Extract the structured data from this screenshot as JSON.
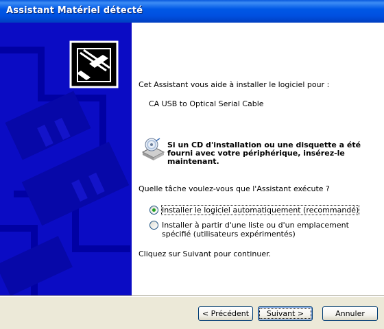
{
  "window": {
    "title": "Assistant Matériel détecté"
  },
  "content": {
    "intro": "Cet Assistant vous aide à installer le logiciel pour :",
    "device_name": "CA USB to Optical Serial Cable",
    "cd_notice": "Si un CD d'installation ou une disquette a été fourni avec votre périphérique, insérez-le maintenant.",
    "question": "Quelle tâche voulez-vous que l'Assistant exécute ?",
    "options": [
      {
        "label": "Installer le logiciel automatiquement (recommandé)",
        "selected": true
      },
      {
        "label": "Installer à partir d'une liste ou d'un emplacement spécifié (utilisateurs expérimentés)",
        "selected": false
      }
    ],
    "continue_hint": "Cliquez sur Suivant pour continuer."
  },
  "buttons": {
    "back": "< Précédent",
    "next": "Suivant >",
    "cancel": "Annuler"
  },
  "colors": {
    "titlebar": "#0058e6",
    "banner": "#0b0cc4",
    "dialog_bg": "#ece9d8",
    "radio_dot": "#21a121"
  }
}
